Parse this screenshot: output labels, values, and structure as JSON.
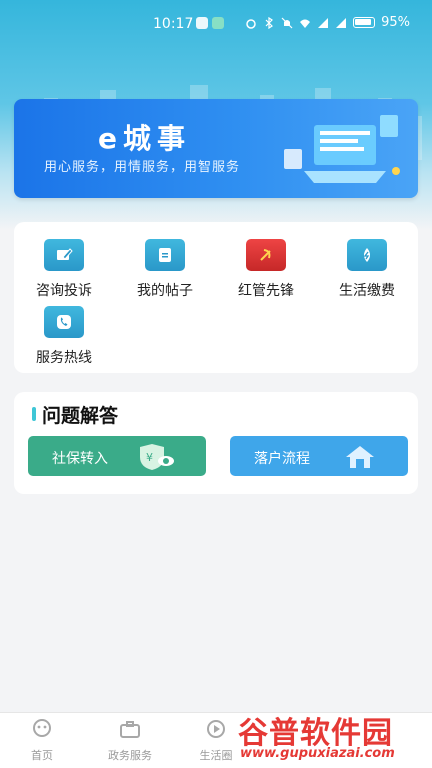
{
  "status_bar": {
    "time": "10:17",
    "battery_pct": "95%",
    "icons": [
      "shield-icon",
      "app-icon",
      "alarm-icon",
      "bluetooth-icon",
      "mute-icon",
      "wifi-icon",
      "signal-icon",
      "battery-icon"
    ]
  },
  "banner": {
    "title": "e城事",
    "subtitle": "用心服务，用情服务，用智服务"
  },
  "services": {
    "items": [
      {
        "label": "咨询投诉",
        "icon": "edit-icon"
      },
      {
        "label": "我的帖子",
        "icon": "document-icon"
      },
      {
        "label": "红管先锋",
        "icon": "party-emblem-icon"
      },
      {
        "label": "生活缴费",
        "icon": "payment-icon"
      },
      {
        "label": "服务热线",
        "icon": "phone-icon"
      }
    ]
  },
  "qa": {
    "title": "问题解答",
    "buttons": [
      {
        "label": "社保转入",
        "icon": "shield-money-icon"
      },
      {
        "label": "落户流程",
        "icon": "house-icon"
      }
    ]
  },
  "tabbar": {
    "items": [
      {
        "label": "首页",
        "icon": "home-icon"
      },
      {
        "label": "政务服务",
        "icon": "briefcase-icon"
      },
      {
        "label": "生活圈",
        "icon": "play-icon"
      }
    ]
  },
  "watermark": {
    "main": "谷普软件园",
    "url": "www.gupuxiazai.com"
  },
  "colors": {
    "header": "#35b6dc",
    "banner": "#1b74e8",
    "service_icon": "#2a98c9",
    "green_button": "#3aab89",
    "blue_button": "#3fa6ea",
    "accent_bar": "#3fc6d6",
    "watermark": "#e53935"
  }
}
